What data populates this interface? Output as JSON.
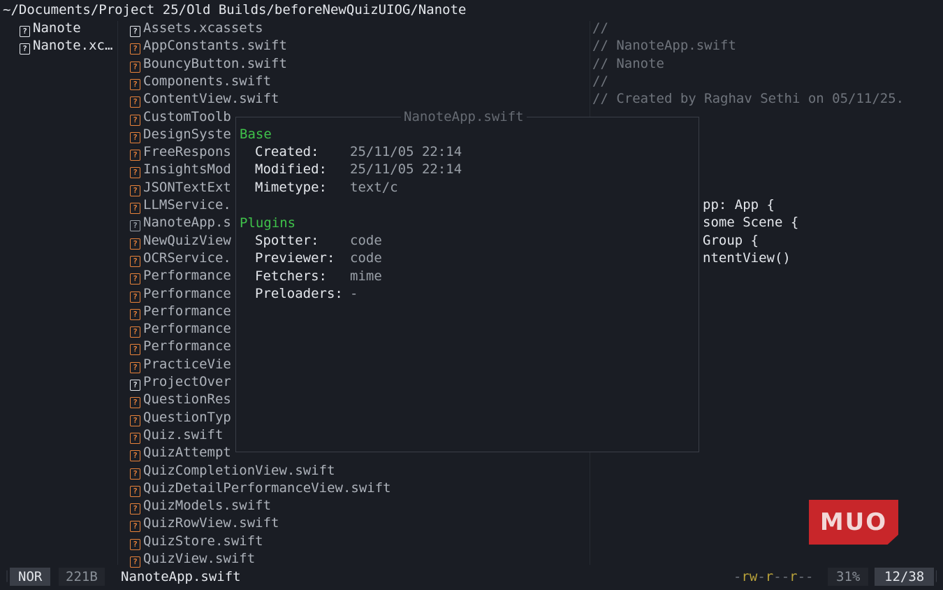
{
  "path": "~/Documents/Project 25/Old Builds/beforeNewQuizUIOG/Nanote",
  "parent": [
    {
      "label": "Nanote"
    },
    {
      "label": "Nanote.xc…"
    }
  ],
  "files": [
    {
      "label": "Assets.xcassets",
      "icon": "white"
    },
    {
      "label": "AppConstants.swift",
      "icon": "orange"
    },
    {
      "label": "BouncyButton.swift",
      "icon": "orange"
    },
    {
      "label": "Components.swift",
      "icon": "orange"
    },
    {
      "label": "ContentView.swift",
      "icon": "orange"
    },
    {
      "label": "CustomToolb",
      "icon": "orange"
    },
    {
      "label": "DesignSyste",
      "icon": "orange"
    },
    {
      "label": "FreeRespons",
      "icon": "orange"
    },
    {
      "label": "InsightsMod",
      "icon": "orange"
    },
    {
      "label": "JSONTextExt",
      "icon": "orange"
    },
    {
      "label": "LLMService.",
      "icon": "orange"
    },
    {
      "label": "NanoteApp.s",
      "icon": "gray"
    },
    {
      "label": "NewQuizView",
      "icon": "orange"
    },
    {
      "label": "OCRService.",
      "icon": "orange"
    },
    {
      "label": "Performance",
      "icon": "orange"
    },
    {
      "label": "Performance",
      "icon": "orange"
    },
    {
      "label": "Performance",
      "icon": "orange"
    },
    {
      "label": "Performance",
      "icon": "orange"
    },
    {
      "label": "Performance",
      "icon": "orange"
    },
    {
      "label": "PracticeVie",
      "icon": "orange"
    },
    {
      "label": "ProjectOver",
      "icon": "white"
    },
    {
      "label": "QuestionRes",
      "icon": "orange"
    },
    {
      "label": "QuestionTyp",
      "icon": "orange"
    },
    {
      "label": "Quiz.swift",
      "icon": "orange"
    },
    {
      "label": "QuizAttempt",
      "icon": "orange"
    },
    {
      "label": "QuizCompletionView.swift",
      "icon": "orange"
    },
    {
      "label": "QuizDetailPerformanceView.swift",
      "icon": "orange"
    },
    {
      "label": "QuizModels.swift",
      "icon": "orange"
    },
    {
      "label": "QuizRowView.swift",
      "icon": "orange"
    },
    {
      "label": "QuizStore.swift",
      "icon": "orange"
    },
    {
      "label": "QuizView.swift",
      "icon": "orange"
    }
  ],
  "preview_comments": [
    "//",
    "//  NanoteApp.swift",
    "//  Nanote",
    "//",
    "//  Created by Raghav Sethi on 05/11/25."
  ],
  "preview_code": [
    "pp: App {",
    "some Scene {",
    "Group {",
    "ntentView()"
  ],
  "popup": {
    "title": "NanoteApp.swift",
    "base_heading": "Base",
    "base": [
      {
        "key": "Created:",
        "value": "25/11/05 22:14"
      },
      {
        "key": "Modified:",
        "value": "25/11/05 22:14"
      },
      {
        "key": "Mimetype:",
        "value": "text/c"
      }
    ],
    "plugins_heading": "Plugins",
    "plugins": [
      {
        "key": "Spotter:",
        "value": "code"
      },
      {
        "key": "Previewer:",
        "value": "code"
      },
      {
        "key": "Fetchers:",
        "value": "mime"
      },
      {
        "key": "Preloaders:",
        "value": "-"
      }
    ]
  },
  "status": {
    "mode": "NOR",
    "size": "221B",
    "filename": "NanoteApp.swift",
    "perm_dash": "-",
    "perm_rw": "rw",
    "perm_dash2": "-",
    "perm_r1": "r",
    "perm_dash3": "--",
    "perm_r2": "r",
    "perm_dash4": "--",
    "percent": "31%",
    "position": "12/38"
  },
  "logo": {
    "text": "MUO"
  },
  "colors": {
    "background": "#1a1d24",
    "accent_orange": "#e8823a",
    "section_green": "#3fc24a",
    "logo_red": "#c8262a"
  }
}
